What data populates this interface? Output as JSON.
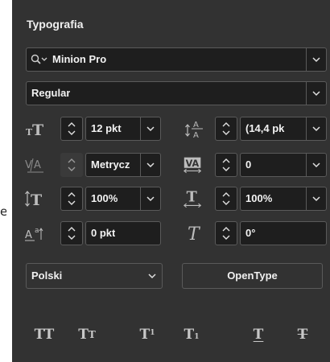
{
  "edge_fragment": "e",
  "panel": {
    "title": "Typografia",
    "font_family": "Minion Pro",
    "font_style": "Regular",
    "font_size": "12 pkt",
    "leading": "(14,4 pk",
    "kerning": "Metrycz",
    "tracking": "0",
    "vertical_scale": "100%",
    "horizontal_scale": "100%",
    "baseline_shift": "0 pkt",
    "skew": "0°",
    "language": "Polski",
    "opentype_label": "OpenType",
    "style_buttons": {
      "all_caps": "TT",
      "small_caps_big": "T",
      "small_caps_small": "T",
      "superscript_base": "T",
      "superscript_mark": "1",
      "subscript_base": "T",
      "subscript_mark": "1",
      "underline": "T",
      "strikethrough": "T"
    }
  },
  "colors": {
    "panel_bg": "#323232",
    "field_bg": "#1e1e1e",
    "border": "#5a5a5a",
    "text": "#f0f0f0",
    "icon": "#bdbdbd"
  }
}
